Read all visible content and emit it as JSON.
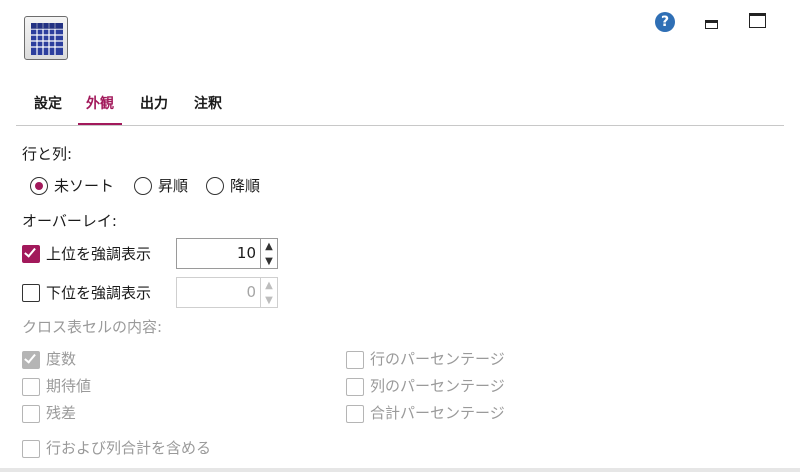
{
  "tabs": [
    {
      "label": "設定"
    },
    {
      "label": "外観"
    },
    {
      "label": "出力"
    },
    {
      "label": "注釈"
    }
  ],
  "rows_columns": {
    "heading": "行と列:",
    "options": [
      {
        "label": "未ソート",
        "selected": true
      },
      {
        "label": "昇順",
        "selected": false
      },
      {
        "label": "降順",
        "selected": false
      }
    ]
  },
  "overlay": {
    "heading": "オーバーレイ:",
    "top": {
      "label": "上位を強調表示",
      "checked": true,
      "value": "10"
    },
    "bottom": {
      "label": "下位を強調表示",
      "checked": false,
      "value": "0"
    }
  },
  "crosstab": {
    "heading": "クロス表セルの内容:",
    "left": [
      {
        "label": "度数",
        "checked": true
      },
      {
        "label": "期待値",
        "checked": false
      },
      {
        "label": "残差",
        "checked": false
      }
    ],
    "right": [
      {
        "label": "行のパーセンテージ",
        "checked": false
      },
      {
        "label": "列のパーセンテージ",
        "checked": false
      },
      {
        "label": "合計パーセンテージ",
        "checked": false
      }
    ],
    "include_totals": {
      "label": "行および列合計を含める",
      "checked": false
    }
  },
  "colors": {
    "accent": "#a2195b",
    "help": "#2f6fb5",
    "disabled": "#9a9a9a"
  }
}
